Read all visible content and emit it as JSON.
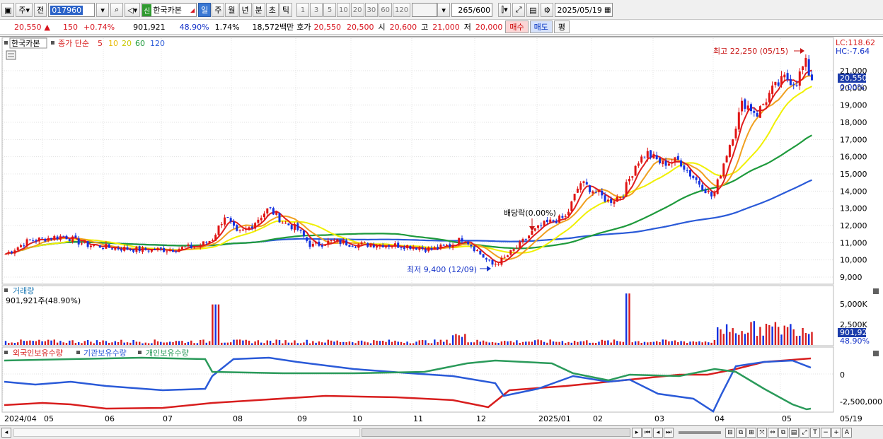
{
  "toolbar": {
    "period_type": "주",
    "prev_label": "전",
    "code": "017960",
    "market_badge": "신",
    "stock_name": "한국카본",
    "periods": [
      "일",
      "주",
      "월",
      "년",
      "분",
      "초",
      "틱"
    ],
    "active_period": "일",
    "intervals": [
      "1",
      "3",
      "5",
      "10",
      "20",
      "30",
      "60",
      "120"
    ],
    "count": "265",
    "count_total": "/600",
    "date": "2025/05/19"
  },
  "quote": {
    "price": "20,550",
    "arrow": "▲",
    "change": "150",
    "change_pct": "+0.74%",
    "volume": "901,921",
    "volume_ratio": "48.90%",
    "turnover_pct": "1.74%",
    "amount": "18,572백만",
    "ask_label": "호가",
    "ask": "20,550",
    "bid": "20,500",
    "open_label": "시",
    "open": "20,600",
    "high_label": "고",
    "high": "21,000",
    "low_label": "저",
    "low": "20,000",
    "buy_label": "매수",
    "sell_label": "매도",
    "eval_label": "평"
  },
  "price_pane": {
    "stock_name": "한국카본",
    "indicator_label": "종가 단순",
    "ma_periods": [
      "5",
      "10",
      "20",
      "60",
      "120"
    ],
    "ma_colors": [
      "#e01e1e",
      "#ffd700",
      "#f0f000",
      "#1e9a3c",
      "#2a5ad8"
    ],
    "lc": "LC:118.62",
    "hc": "HC:-7.64",
    "current_price": "20,550",
    "current_pct": "0.00%",
    "high_note": "최고 22,250 (05/15)",
    "low_note": "최저 9,400 (12/09)",
    "dividend_note": "배당락(0.00%)",
    "y_ticks": [
      "21,000",
      "20,000",
      "19,000",
      "18,000",
      "17,000",
      "16,000",
      "15,000",
      "14,000",
      "13,000",
      "12,000",
      "11,000",
      "10,000",
      "9,000"
    ]
  },
  "volume_pane": {
    "title": "거래량",
    "subtitle": "901,921주(48.90%)",
    "y_ticks": [
      "5,000K",
      "2,500K"
    ],
    "current": "901,921",
    "current_pct": "48.90%"
  },
  "holdings_pane": {
    "series": [
      "외국인보유수량",
      "기관보유수량",
      "개인보유수량"
    ],
    "colors": [
      "#d81e1e",
      "#2a5ad8",
      "#2a9a5a"
    ],
    "y_ticks": [
      "0",
      "-2,500,000"
    ]
  },
  "x_axis": {
    "labels": [
      "2024/04",
      "05",
      "06",
      "07",
      "08",
      "09",
      "10",
      "11",
      "12",
      "2025/01",
      "02",
      "03",
      "04",
      "05",
      "05/19"
    ]
  },
  "chart_data": {
    "type": "line",
    "title": "",
    "x": [
      "2024/04",
      "05",
      "06",
      "07",
      "08",
      "09",
      "10",
      "11",
      "12",
      "2025/01",
      "02",
      "03",
      "04",
      "05"
    ],
    "ylim": [
      9000,
      22250
    ],
    "series": [
      {
        "name": "종가 단순 5",
        "values": [
          10700,
          10900,
          10600,
          10700,
          12600,
          11000,
          10950,
          10800,
          9700,
          12100,
          14200,
          15800,
          18800,
          21000
        ]
      },
      {
        "name": "종가 단순 120",
        "values": [
          11100,
          10950,
          10800,
          10750,
          10800,
          10900,
          10950,
          11000,
          11000,
          11100,
          11500,
          12200,
          12900,
          14500
        ]
      }
    ]
  }
}
